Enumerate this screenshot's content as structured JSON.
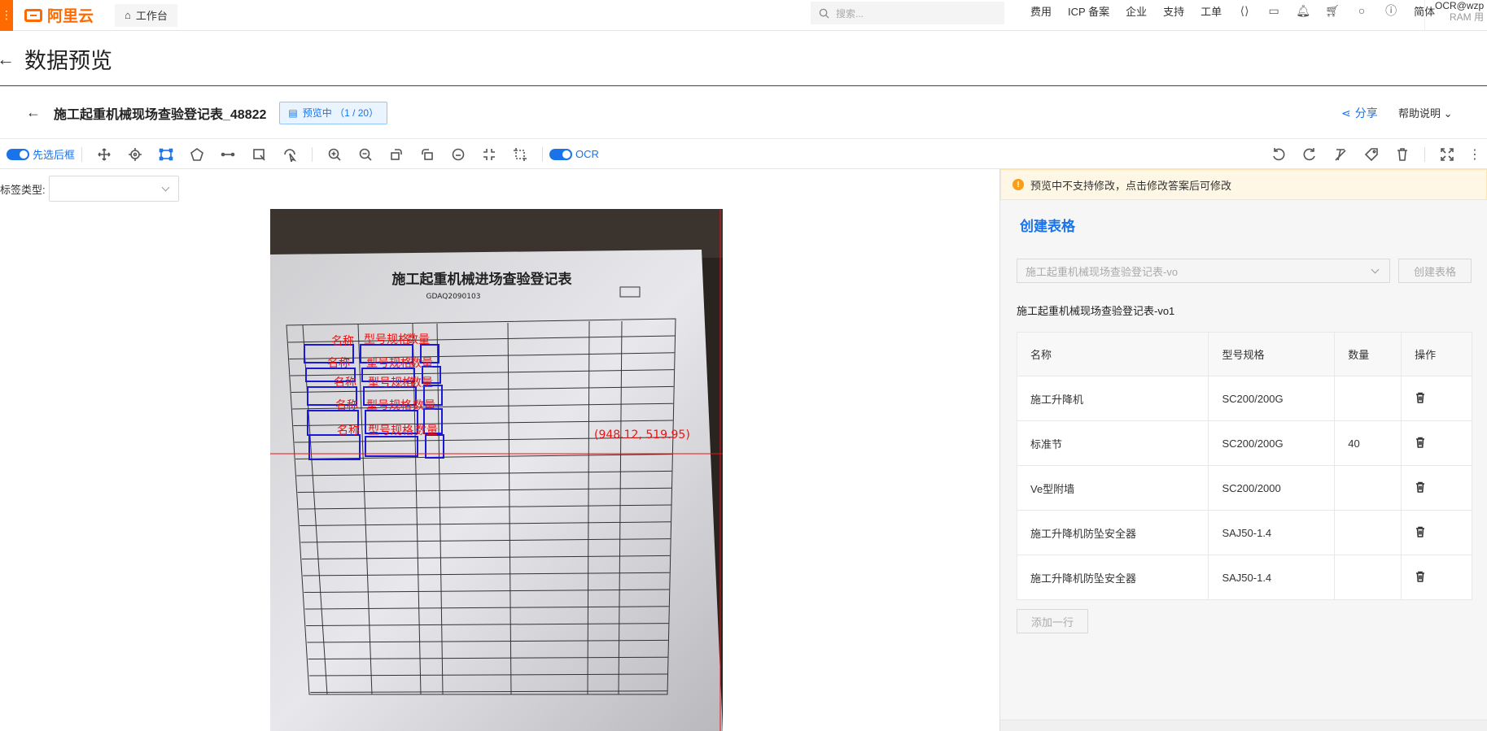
{
  "topbar": {
    "brand": "阿里云",
    "workbench": "工作台",
    "search_placeholder": "搜索...",
    "nav": [
      "费用",
      "ICP 备案",
      "企业",
      "支持",
      "工单"
    ],
    "lang": "简体",
    "account": "OCR@wzp",
    "account_sub": "RAM 用"
  },
  "page": {
    "title": "数据预览"
  },
  "doc": {
    "title": "施工起重机械现场查验登记表_48822",
    "status": "预览中  （1 / 20）",
    "share": "分享",
    "help": "帮助说明"
  },
  "toolbar": {
    "toggle_label": "先选后框",
    "ocr_label": "OCR"
  },
  "left": {
    "label_type": "标签类型:"
  },
  "canvas": {
    "coord_readout": "(948.12, 519.95)",
    "doc_title": "施工起重机械进场查验登记表",
    "doc_code": "GDAQ2090103",
    "box_labels": [
      "名称",
      "型号规格",
      "数量"
    ]
  },
  "right": {
    "warning": "预览中不支持修改，点击修改答案后可修改",
    "create_title": "创建表格",
    "template_select": "施工起重机械现场查验登记表-vo",
    "create_button": "创建表格",
    "table_name": "施工起重机械现场查验登记表-vo1",
    "columns": [
      "名称",
      "型号规格",
      "数量",
      "操作"
    ],
    "rows": [
      [
        "施工升降机",
        "SC200/200G",
        ""
      ],
      [
        "标准节",
        "SC200/200G",
        "40"
      ],
      [
        "Ve型附墙",
        "SC200/2000",
        ""
      ],
      [
        "施工升降机防坠安全器",
        "SAJ50-1.4",
        ""
      ],
      [
        "施工升降机防坠安全器",
        "SAJ50-1.4",
        ""
      ]
    ],
    "add_row": "添加一行"
  }
}
